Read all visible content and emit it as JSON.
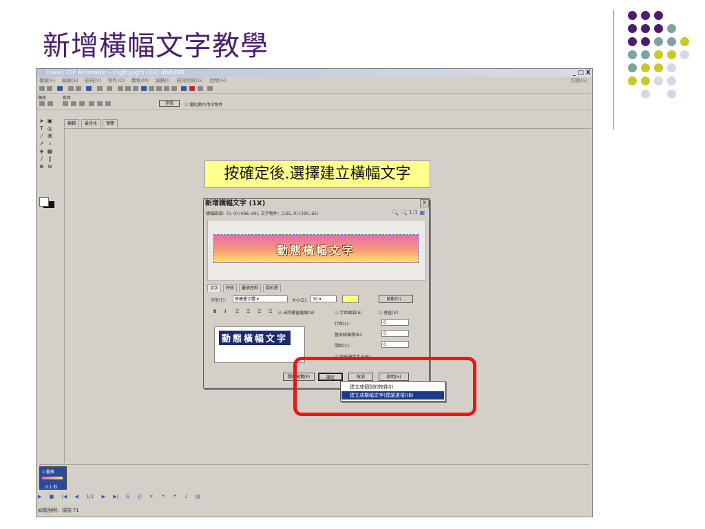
{
  "slide": {
    "title": "新增橫幅文字教學",
    "dot_colors": [
      "#4b1e6d",
      "#7fa3a1",
      "#c9c92a",
      "#d7d6e6"
    ]
  },
  "app": {
    "title": "Ulead GIF Animator - [bg0.jpg*] (1X) 468x60",
    "window_controls": "_ □ X",
    "menu_items": [
      "檔案(F)",
      "編輯(E)",
      "檢視(V)",
      "物件(O)",
      "畫格(M)",
      "濾鏡(I)",
      "視訊特效(G)",
      "說明(H)"
    ],
    "menu_right": "切換(S)",
    "toolbar_labels": [
      "順序",
      "對齊"
    ],
    "toolbar_checkbox": "優化動作用中物件",
    "toolbar_button": "存放",
    "tabs": [
      "編輯",
      "最佳化",
      "預覽"
    ],
    "status": "如需說明，請按 F1"
  },
  "callout": {
    "text": "按確定後.選擇建立橫幅文字"
  },
  "dialog": {
    "title": "新增橫幅文字 (1X)",
    "close": "X",
    "info": "橫幅區域：(0, 0)-(468, 60), 文字物件：(125, 9)-(330, 65)",
    "zoom": "🔍 🔍 1:1 ▦",
    "preview_text": "動態橫幅文字",
    "tabs": [
      "文字",
      "特效",
      "畫格控制",
      "霓虹燈"
    ],
    "font_label": "字型(F):",
    "font_value": "華康墨字體",
    "size_label": "大小(Z):",
    "size_value": "30",
    "shadow_button": "陰影(D)...",
    "checks": {
      "antialias": "去除鋸齒邊緣(N)",
      "kerning": "字距微調(E)",
      "vertical": "垂直(V)",
      "auto_size": "調成適當大小(R)"
    },
    "spacing_labels": [
      "行距(L):",
      "基底線偏移(B):",
      "間距(C):"
    ],
    "spacing_values": [
      "0",
      "0",
      "0"
    ],
    "text_sample": "動態橫幅文字",
    "buttons": {
      "start_preview": "開始預覽(P)",
      "ok": "確定",
      "cancel": "取消",
      "help": "說明(H)"
    }
  },
  "context_menu": {
    "items": [
      {
        "label": "建立成個別的物件(I)",
        "selected": false
      },
      {
        "label": "建立成橫幅文字(建議選項)(B)",
        "selected": true
      }
    ]
  },
  "frames": {
    "frame_label": "1:畫格",
    "duration": "0.1 秒"
  },
  "bottom_toolbar": [
    "▶",
    "■",
    "|◀",
    "◀",
    "1/1",
    "▶",
    "▶|",
    "⎘",
    "⎗",
    "✕",
    "↰",
    "↱",
    "♪",
    "▤"
  ]
}
